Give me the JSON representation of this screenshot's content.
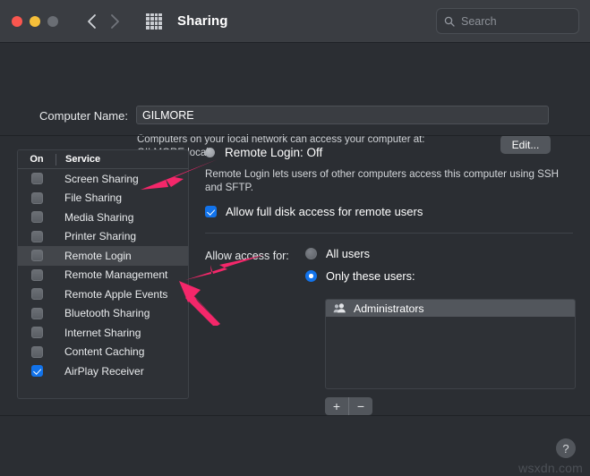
{
  "window": {
    "title": "Sharing",
    "traffic_lights": [
      "close-red",
      "minimize-yellow",
      "zoom-gray"
    ],
    "colors": {
      "accent_blue": "#1273eb",
      "annotation_pink": "#f4276a",
      "toolbar_bg": "#3a3d42",
      "window_bg": "#2b2e33",
      "close_red": "#f9564f",
      "minimize_yellow": "#f5bf3a",
      "zoom_gray": "#6a6e74"
    }
  },
  "toolbar": {
    "back_label": "Back",
    "forward_label": "Forward",
    "grid_label": "Show All",
    "title": "Sharing",
    "search": {
      "placeholder": "Search",
      "value": ""
    }
  },
  "computer_name": {
    "label": "Computer Name:",
    "value": "GILMORE",
    "help_text": "Computers on your local network can access your computer at: GILMORE.local",
    "edit_button": "Edit..."
  },
  "service_list": {
    "headers": {
      "on": "On",
      "service": "Service"
    },
    "rows": [
      {
        "label": "Screen Sharing",
        "checked": false,
        "selected": false
      },
      {
        "label": "File Sharing",
        "checked": false,
        "selected": false
      },
      {
        "label": "Media Sharing",
        "checked": false,
        "selected": false
      },
      {
        "label": "Printer Sharing",
        "checked": false,
        "selected": false
      },
      {
        "label": "Remote Login",
        "checked": false,
        "selected": true
      },
      {
        "label": "Remote Management",
        "checked": false,
        "selected": false
      },
      {
        "label": "Remote Apple Events",
        "checked": false,
        "selected": false
      },
      {
        "label": "Bluetooth Sharing",
        "checked": false,
        "selected": false
      },
      {
        "label": "Internet Sharing",
        "checked": false,
        "selected": false
      },
      {
        "label": "Content Caching",
        "checked": false,
        "selected": false
      },
      {
        "label": "AirPlay Receiver",
        "checked": true,
        "selected": false
      }
    ]
  },
  "detail": {
    "status_text": "Remote Login: Off",
    "description": "Remote Login lets users of other computers access this computer using SSH and SFTP.",
    "full_disk": {
      "label": "Allow full disk access for remote users",
      "checked": true
    },
    "access": {
      "label": "Allow access for:",
      "options": [
        {
          "label": "All users",
          "selected": false
        },
        {
          "label": "Only these users:",
          "selected": true
        }
      ]
    },
    "users": [
      {
        "name": "Administrators",
        "icon": "group-icon",
        "selected": true
      }
    ],
    "add_button": "+",
    "remove_button": "−"
  },
  "footer": {
    "help_button": "?",
    "watermark": "wsxdn.com"
  },
  "annotations": [
    {
      "name": "arrow-screen-sharing",
      "target": "Screen Sharing"
    },
    {
      "name": "arrow-allow-access",
      "target": "Allow access for:"
    },
    {
      "name": "arrow-remote-management",
      "target": "Remote Management"
    }
  ]
}
